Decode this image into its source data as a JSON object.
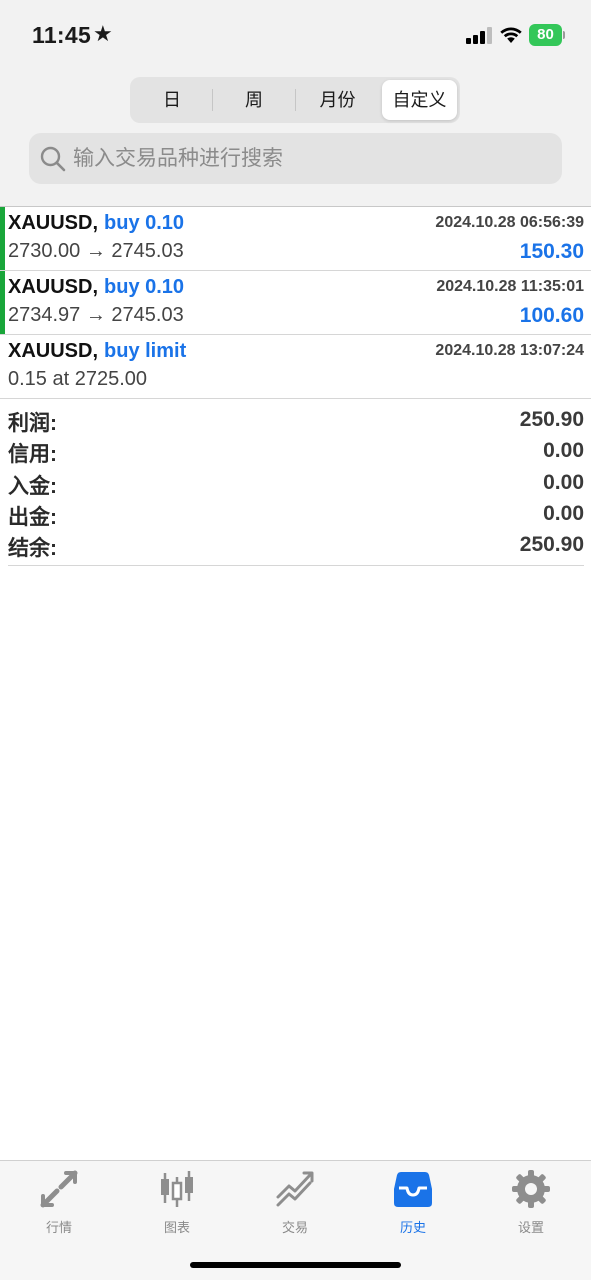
{
  "status": {
    "time": "11:45",
    "battery": "80"
  },
  "segments": [
    "日",
    "周",
    "月份",
    "自定义"
  ],
  "active_segment": "自定义",
  "search": {
    "placeholder": "输入交易品种进行搜索",
    "value": ""
  },
  "trades": [
    {
      "symbol": "XAUUSD,",
      "action": "buy 0.10",
      "datetime": "2024.10.28 06:56:39",
      "prices": "2730.00 → 2745.03",
      "profit": "150.30"
    },
    {
      "symbol": "XAUUSD,",
      "action": "buy 0.10",
      "datetime": "2024.10.28 11:35:01",
      "prices": "2734.97 → 2745.03",
      "profit": "100.60"
    },
    {
      "symbol": "XAUUSD,",
      "action": "buy limit",
      "datetime": "2024.10.28 13:07:24",
      "prices": "0.15 at 2725.00",
      "profit": ""
    }
  ],
  "summary": [
    {
      "label": "利润:",
      "value": "250.90"
    },
    {
      "label": "信用:",
      "value": "0.00"
    },
    {
      "label": "入金:",
      "value": "0.00"
    },
    {
      "label": "出金:",
      "value": "0.00"
    },
    {
      "label": "结余:",
      "value": "250.90"
    }
  ],
  "tabs": [
    {
      "label": "行情",
      "icon": "quotes-arrows-icon"
    },
    {
      "label": "图表",
      "icon": "candlestick-chart-icon"
    },
    {
      "label": "交易",
      "icon": "trade-trend-icon"
    },
    {
      "label": "历史",
      "icon": "history-inbox-icon"
    },
    {
      "label": "设置",
      "icon": "settings-gear-icon"
    }
  ],
  "active_tab": "历史",
  "colors": {
    "accent": "#1a73e8",
    "buy_bar": "#19a63a",
    "battery": "#34c759"
  }
}
